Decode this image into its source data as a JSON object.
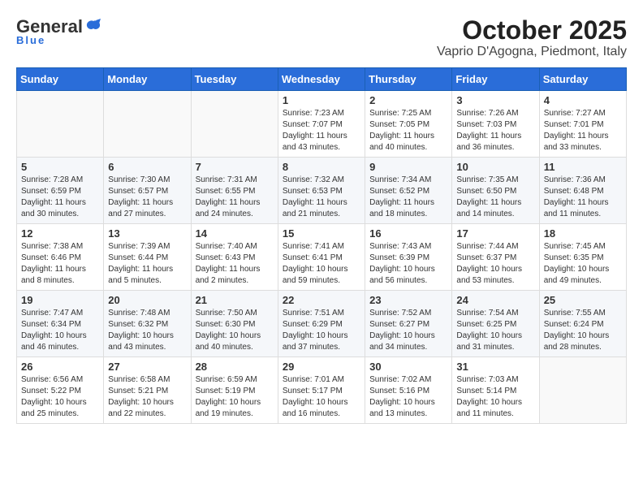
{
  "logo": {
    "general": "General",
    "blue": "Blue",
    "tagline": "Blue"
  },
  "title": "October 2025",
  "subtitle": "Vaprio D'Agogna, Piedmont, Italy",
  "days_of_week": [
    "Sunday",
    "Monday",
    "Tuesday",
    "Wednesday",
    "Thursday",
    "Friday",
    "Saturday"
  ],
  "weeks": [
    [
      {
        "day": "",
        "info": ""
      },
      {
        "day": "",
        "info": ""
      },
      {
        "day": "",
        "info": ""
      },
      {
        "day": "1",
        "info": "Sunrise: 7:23 AM\nSunset: 7:07 PM\nDaylight: 11 hours and 43 minutes."
      },
      {
        "day": "2",
        "info": "Sunrise: 7:25 AM\nSunset: 7:05 PM\nDaylight: 11 hours and 40 minutes."
      },
      {
        "day": "3",
        "info": "Sunrise: 7:26 AM\nSunset: 7:03 PM\nDaylight: 11 hours and 36 minutes."
      },
      {
        "day": "4",
        "info": "Sunrise: 7:27 AM\nSunset: 7:01 PM\nDaylight: 11 hours and 33 minutes."
      }
    ],
    [
      {
        "day": "5",
        "info": "Sunrise: 7:28 AM\nSunset: 6:59 PM\nDaylight: 11 hours and 30 minutes."
      },
      {
        "day": "6",
        "info": "Sunrise: 7:30 AM\nSunset: 6:57 PM\nDaylight: 11 hours and 27 minutes."
      },
      {
        "day": "7",
        "info": "Sunrise: 7:31 AM\nSunset: 6:55 PM\nDaylight: 11 hours and 24 minutes."
      },
      {
        "day": "8",
        "info": "Sunrise: 7:32 AM\nSunset: 6:53 PM\nDaylight: 11 hours and 21 minutes."
      },
      {
        "day": "9",
        "info": "Sunrise: 7:34 AM\nSunset: 6:52 PM\nDaylight: 11 hours and 18 minutes."
      },
      {
        "day": "10",
        "info": "Sunrise: 7:35 AM\nSunset: 6:50 PM\nDaylight: 11 hours and 14 minutes."
      },
      {
        "day": "11",
        "info": "Sunrise: 7:36 AM\nSunset: 6:48 PM\nDaylight: 11 hours and 11 minutes."
      }
    ],
    [
      {
        "day": "12",
        "info": "Sunrise: 7:38 AM\nSunset: 6:46 PM\nDaylight: 11 hours and 8 minutes."
      },
      {
        "day": "13",
        "info": "Sunrise: 7:39 AM\nSunset: 6:44 PM\nDaylight: 11 hours and 5 minutes."
      },
      {
        "day": "14",
        "info": "Sunrise: 7:40 AM\nSunset: 6:43 PM\nDaylight: 11 hours and 2 minutes."
      },
      {
        "day": "15",
        "info": "Sunrise: 7:41 AM\nSunset: 6:41 PM\nDaylight: 10 hours and 59 minutes."
      },
      {
        "day": "16",
        "info": "Sunrise: 7:43 AM\nSunset: 6:39 PM\nDaylight: 10 hours and 56 minutes."
      },
      {
        "day": "17",
        "info": "Sunrise: 7:44 AM\nSunset: 6:37 PM\nDaylight: 10 hours and 53 minutes."
      },
      {
        "day": "18",
        "info": "Sunrise: 7:45 AM\nSunset: 6:35 PM\nDaylight: 10 hours and 49 minutes."
      }
    ],
    [
      {
        "day": "19",
        "info": "Sunrise: 7:47 AM\nSunset: 6:34 PM\nDaylight: 10 hours and 46 minutes."
      },
      {
        "day": "20",
        "info": "Sunrise: 7:48 AM\nSunset: 6:32 PM\nDaylight: 10 hours and 43 minutes."
      },
      {
        "day": "21",
        "info": "Sunrise: 7:50 AM\nSunset: 6:30 PM\nDaylight: 10 hours and 40 minutes."
      },
      {
        "day": "22",
        "info": "Sunrise: 7:51 AM\nSunset: 6:29 PM\nDaylight: 10 hours and 37 minutes."
      },
      {
        "day": "23",
        "info": "Sunrise: 7:52 AM\nSunset: 6:27 PM\nDaylight: 10 hours and 34 minutes."
      },
      {
        "day": "24",
        "info": "Sunrise: 7:54 AM\nSunset: 6:25 PM\nDaylight: 10 hours and 31 minutes."
      },
      {
        "day": "25",
        "info": "Sunrise: 7:55 AM\nSunset: 6:24 PM\nDaylight: 10 hours and 28 minutes."
      }
    ],
    [
      {
        "day": "26",
        "info": "Sunrise: 6:56 AM\nSunset: 5:22 PM\nDaylight: 10 hours and 25 minutes."
      },
      {
        "day": "27",
        "info": "Sunrise: 6:58 AM\nSunset: 5:21 PM\nDaylight: 10 hours and 22 minutes."
      },
      {
        "day": "28",
        "info": "Sunrise: 6:59 AM\nSunset: 5:19 PM\nDaylight: 10 hours and 19 minutes."
      },
      {
        "day": "29",
        "info": "Sunrise: 7:01 AM\nSunset: 5:17 PM\nDaylight: 10 hours and 16 minutes."
      },
      {
        "day": "30",
        "info": "Sunrise: 7:02 AM\nSunset: 5:16 PM\nDaylight: 10 hours and 13 minutes."
      },
      {
        "day": "31",
        "info": "Sunrise: 7:03 AM\nSunset: 5:14 PM\nDaylight: 10 hours and 11 minutes."
      },
      {
        "day": "",
        "info": ""
      }
    ]
  ]
}
